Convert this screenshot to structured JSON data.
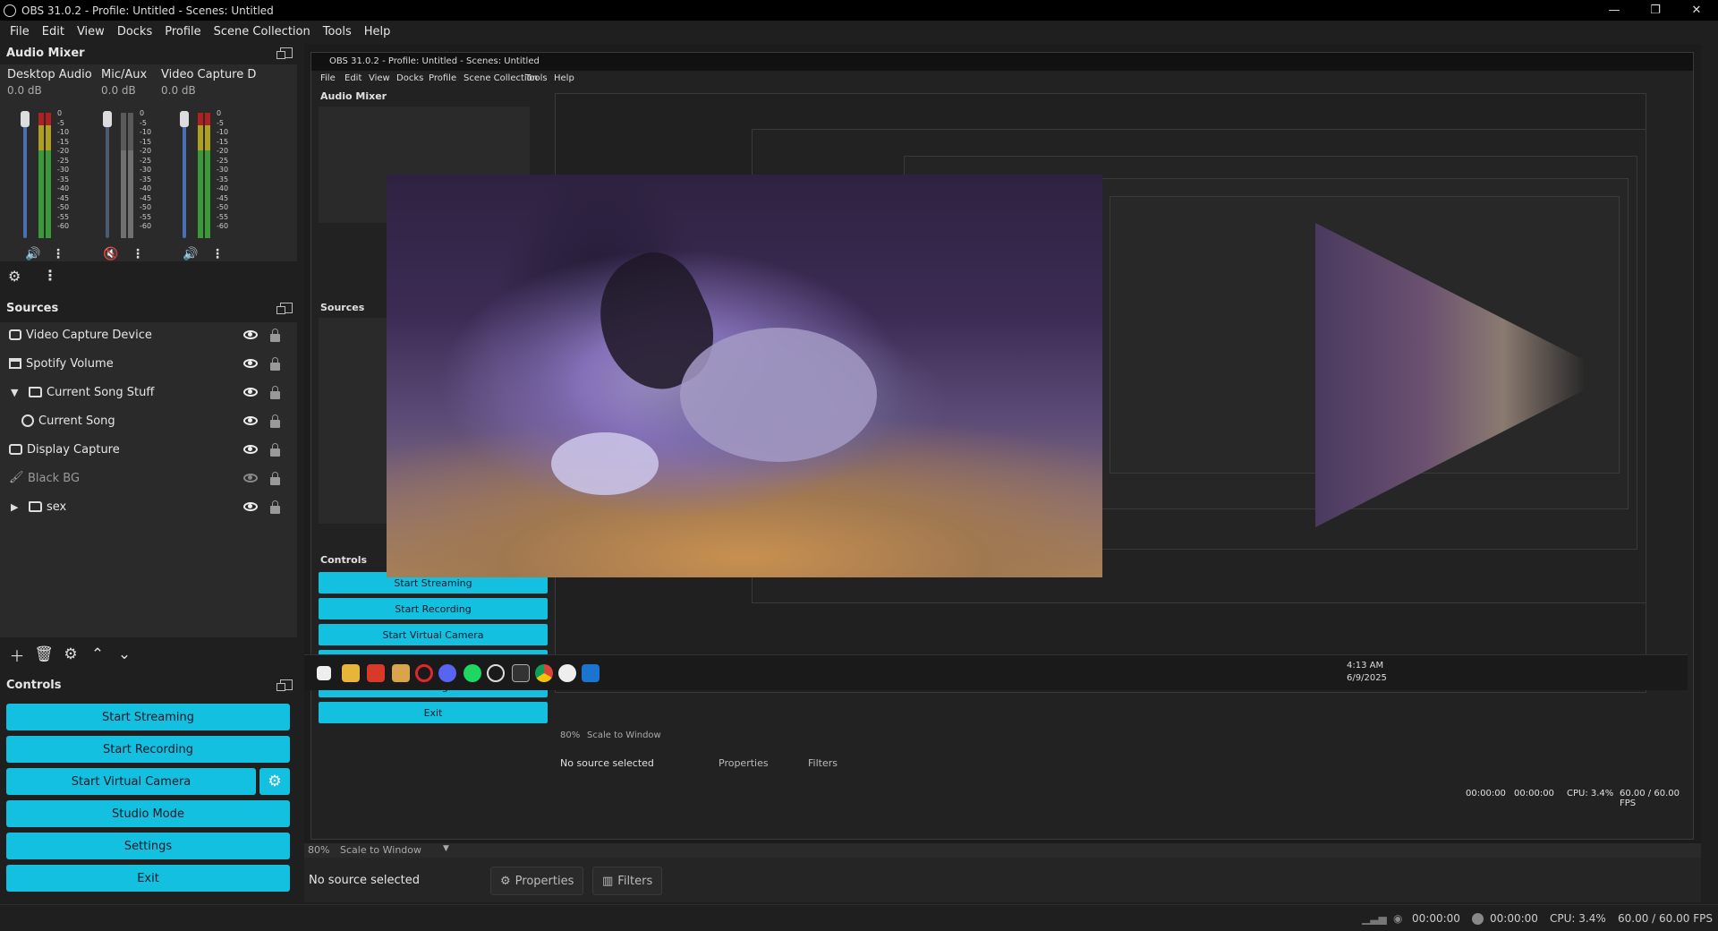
{
  "window": {
    "title": "OBS 31.0.2 - Profile: Untitled - Scenes: Untitled",
    "minimize_glyph": "—",
    "restore_glyph": "❐",
    "close_glyph": "✕"
  },
  "menu": [
    "File",
    "Edit",
    "View",
    "Docks",
    "Profile",
    "Scene Collection",
    "Tools",
    "Help"
  ],
  "audio_mixer": {
    "title": "Audio Mixer",
    "channels": [
      {
        "name": "Desktop Audio",
        "level": "0.0 dB",
        "muted": false
      },
      {
        "name": "Mic/Aux",
        "level": "0.0 dB",
        "muted": true
      },
      {
        "name": "Video Capture D",
        "level": "0.0 dB",
        "muted": false
      }
    ],
    "scale": [
      "0",
      "-5",
      "-10",
      "-15",
      "-20",
      "-25",
      "-30",
      "-35",
      "-40",
      "-45",
      "-50",
      "-55",
      "-60"
    ]
  },
  "sources": {
    "title": "Sources",
    "items": [
      {
        "label": "Video Capture Device",
        "icon": "camera-icon",
        "visible": true,
        "indent": 0
      },
      {
        "label": "Spotify Volume",
        "icon": "window-icon",
        "visible": true,
        "indent": 0
      },
      {
        "label": "Current Song Stuff",
        "icon": "folder-icon",
        "visible": true,
        "indent": 0,
        "expanded": true
      },
      {
        "label": "Current Song",
        "icon": "browser-icon",
        "visible": true,
        "indent": 1
      },
      {
        "label": "Display Capture",
        "icon": "monitor-icon",
        "visible": true,
        "indent": 0
      },
      {
        "label": "Black BG",
        "icon": "brush-icon",
        "visible": false,
        "indent": 0
      },
      {
        "label": "sex",
        "icon": "folder-icon",
        "visible": true,
        "indent": 0,
        "collapsed": true
      }
    ]
  },
  "controls": {
    "title": "Controls",
    "start_streaming": "Start Streaming",
    "start_recording": "Start Recording",
    "start_virtual_camera": "Start Virtual Camera",
    "studio_mode": "Studio Mode",
    "settings": "Settings",
    "exit": "Exit"
  },
  "nested_preview": {
    "title": "OBS 31.0.2 - Profile: Untitled - Scenes: Untitled",
    "mixer_title": "Audio Mixer",
    "sources_title": "Sources",
    "controls_title": "Controls",
    "no_source": "No source selected",
    "properties": "Properties",
    "filters": "Filters",
    "zoom": "80%",
    "scale_mode": "Scale to Window",
    "clock_time": "4:13 AM",
    "clock_date": "6/9/2025",
    "timer1": "00:00:00",
    "timer2": "00:00:00",
    "cpu": "CPU: 3.4%",
    "fps": "60.00 / 60.00 FPS"
  },
  "preview_bar": {
    "zoom": "80%",
    "scale_mode": "Scale to Window"
  },
  "source_toolbar": {
    "no_source": "No source selected",
    "properties": "Properties",
    "filters": "Filters"
  },
  "status": {
    "stream_time": "00:00:00",
    "record_time": "00:00:00",
    "cpu": "CPU: 3.4%",
    "fps": "60.00 / 60.00 FPS"
  }
}
